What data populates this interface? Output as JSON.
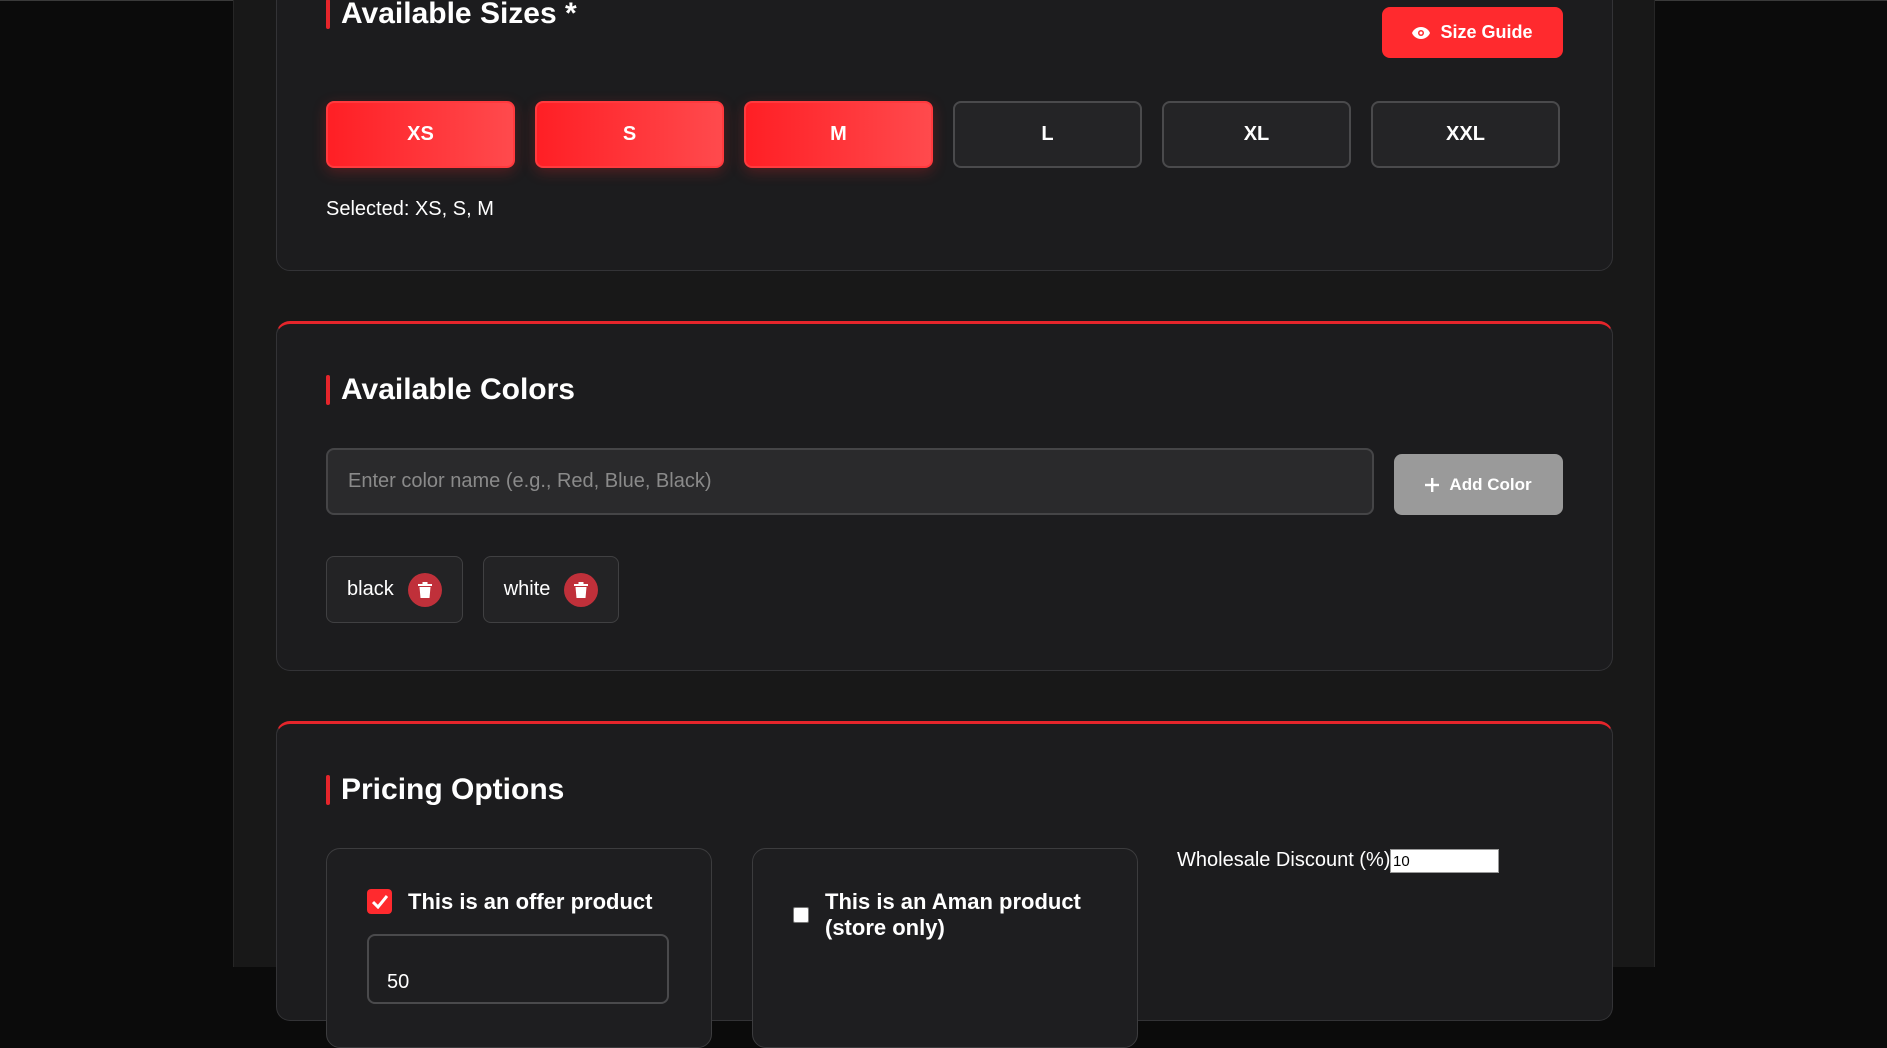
{
  "sizes_section": {
    "title": "Available Sizes *",
    "size_guide_label": "Size Guide",
    "sizes": [
      {
        "label": "XS",
        "selected": true
      },
      {
        "label": "S",
        "selected": true
      },
      {
        "label": "M",
        "selected": true
      },
      {
        "label": "L",
        "selected": false
      },
      {
        "label": "XL",
        "selected": false
      },
      {
        "label": "XXL",
        "selected": false
      }
    ],
    "selected_text": "Selected: XS, S, M"
  },
  "colors_section": {
    "title": "Available Colors",
    "input_placeholder": "Enter color name (e.g., Red, Blue, Black)",
    "input_value": "",
    "add_label": "Add Color",
    "colors": [
      {
        "name": "black"
      },
      {
        "name": "white"
      }
    ]
  },
  "pricing_section": {
    "title": "Pricing Options",
    "offer_label": "This is an offer product",
    "offer_checked": true,
    "offer_value": "50",
    "aman_label": "This is an Aman product (store only)",
    "aman_checked": false,
    "wholesale_label": "Wholesale Discount (%)",
    "wholesale_value": "10"
  },
  "colors": {
    "accent": "#ff2a2e",
    "background": "#181818",
    "card": "#1c1c1e",
    "disabled_button": "#9a9a9a",
    "delete_button": "#c0303a"
  },
  "icons": {
    "size_guide": "eye-icon",
    "add_color": "plus-icon",
    "remove_color": "trash-icon",
    "checkbox": "check-icon"
  }
}
